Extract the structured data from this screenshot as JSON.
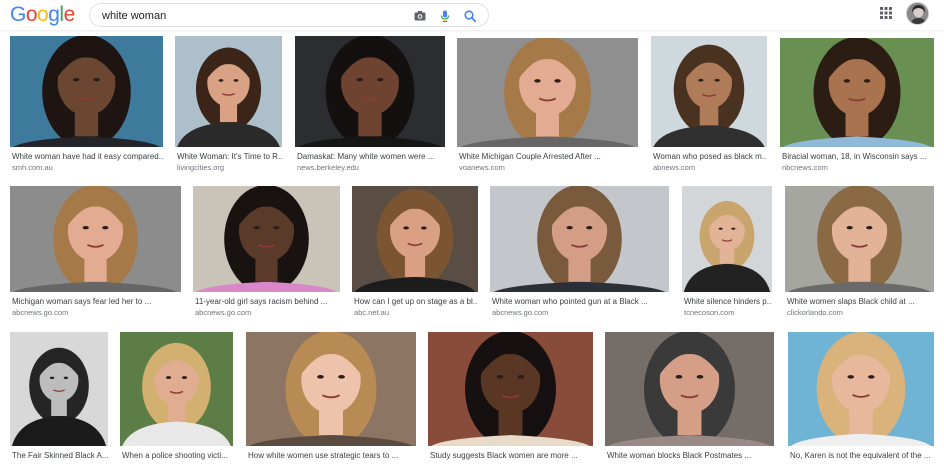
{
  "header": {
    "logo_letters": [
      {
        "ch": "G",
        "color": "#4285F4"
      },
      {
        "ch": "o",
        "color": "#EA4335"
      },
      {
        "ch": "o",
        "color": "#FBBC05"
      },
      {
        "ch": "g",
        "color": "#4285F4"
      },
      {
        "ch": "l",
        "color": "#34A853"
      },
      {
        "ch": "e",
        "color": "#EA4335"
      }
    ],
    "search_value": "white woman",
    "icons": [
      "camera-icon",
      "microphone-icon",
      "search-icon",
      "apps-grid-icon"
    ]
  },
  "results": [
    {
      "caption": "White woman have had it easy compared...",
      "source": "smh.com.au",
      "bg": "#3d7a9c",
      "skin": "#6b4631",
      "hair": "#1e1512",
      "shirt": "#23252a"
    },
    {
      "caption": "White Woman: It's Time to R...",
      "source": "livingcities.org",
      "bg": "#aebfcc",
      "skin": "#d9a285",
      "hair": "#3b2418",
      "shirt": "#2a2a2a"
    },
    {
      "caption": "Damaskat: Many white women were ...",
      "source": "news.berkeley.edu",
      "bg": "#2b2d30",
      "skin": "#6e4430",
      "hair": "#141010",
      "shirt": "#151515"
    },
    {
      "caption": "White Michigan Couple Arrested After ...",
      "source": "voanews.com",
      "bg": "#8f8f8f",
      "skin": "#e3ab92",
      "hair": "#a67a48",
      "shirt": "#666"
    },
    {
      "caption": "Woman who posed as black m...",
      "source": "abnews.com",
      "bg": "#cfd9dd",
      "skin": "#b07b58",
      "hair": "#4a3220",
      "shirt": "#2f2f2f"
    },
    {
      "caption": "Biracial woman, 18, in Wisconsin says ...",
      "source": "nbcnews.com",
      "bg": "#6a8f52",
      "skin": "#a8734e",
      "hair": "#2b1d14",
      "shirt": "#8fb9d8"
    },
    {
      "caption": "Michigan woman says fear led her to ...",
      "source": "abcnews.go.com",
      "bg": "#8c8c8c",
      "skin": "#e3ab92",
      "hair": "#a67a48",
      "shirt": "#666"
    },
    {
      "caption": "11-year-old girl says racism behind ...",
      "source": "abcnews.go.com",
      "bg": "#c9c3b8",
      "skin": "#5a3a28",
      "hair": "#181210",
      "shirt": "#d987c9"
    },
    {
      "caption": "How can I get up on stage as a bl...",
      "source": "abc.net.au",
      "bg": "#5a4e44",
      "skin": "#d9a083",
      "hair": "#7b5532",
      "shirt": "#1c1c1c"
    },
    {
      "caption": "White woman who pointed gun at a Black ...",
      "source": "abcnews.go.com",
      "bg": "#c3c7cb",
      "skin": "#d39e85",
      "hair": "#7a5a3c",
      "shirt": "#2b3038"
    },
    {
      "caption": "White silence hinders p...",
      "source": "tcnecoson.com",
      "bg": "#d3d6d9",
      "skin": "#e3b397",
      "hair": "#c9a56e",
      "shirt": "#222"
    },
    {
      "caption": "White women slaps Black child at ...",
      "source": "clickorlando.com",
      "bg": "#a6a6a0",
      "skin": "#e3b397",
      "hair": "#8a6a45",
      "shirt": "#6a6a6a"
    },
    {
      "caption": "The Fair Skinned Black A...",
      "source": "",
      "bg": "#d8d8d8",
      "skin": "#bdbdbd",
      "hair": "#252525",
      "shirt": "#1b1b1b"
    },
    {
      "caption": "When a police shooting victi...",
      "source": "",
      "bg": "#5d7d47",
      "skin": "#e0ad90",
      "hair": "#d2b06f",
      "shirt": "#e8e8e8"
    },
    {
      "caption": "How white women use strategic tears to ...",
      "source": "",
      "bg": "#8d7563",
      "skin": "#edc3ab",
      "hair": "#b88b54",
      "shirt": "#5a4a40"
    },
    {
      "caption": "Study suggests Black women are more ...",
      "source": "",
      "bg": "#8a4c3a",
      "skin": "#5a3624",
      "hair": "#161110",
      "shirt": "#e8dbc9"
    },
    {
      "caption": "White woman blocks Black Postmates ...",
      "source": "",
      "bg": "#756d67",
      "skin": "#d59e87",
      "hair": "#3a3a3a",
      "shirt": "#9a8a86"
    },
    {
      "caption": "No, Karen is not the equivalent of the ...",
      "source": "",
      "bg": "#6fb3d5",
      "skin": "#e8b89c",
      "hair": "#d9b27c",
      "shirt": "#efefef"
    }
  ]
}
